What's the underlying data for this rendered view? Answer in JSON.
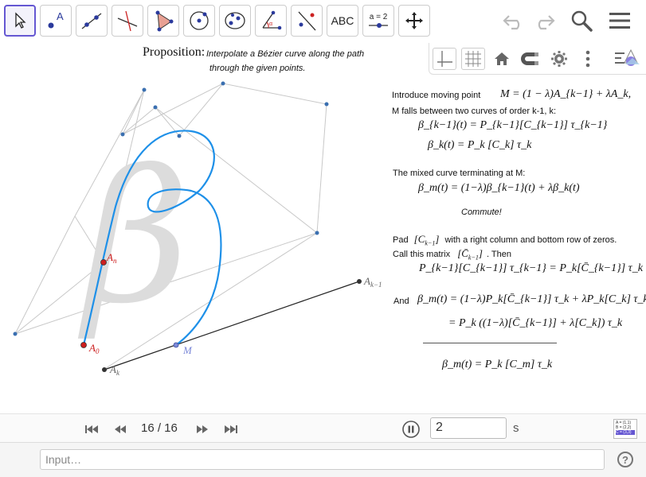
{
  "toolbar": {
    "tools": [
      {
        "name": "move-tool",
        "active": true
      },
      {
        "name": "point-tool"
      },
      {
        "name": "line-tool"
      },
      {
        "name": "perpendicular-line-tool"
      },
      {
        "name": "polygon-tool"
      },
      {
        "name": "circle-tool"
      },
      {
        "name": "ellipse-tool"
      },
      {
        "name": "angle-tool"
      },
      {
        "name": "reflect-tool"
      },
      {
        "name": "text-tool",
        "label": "ABC"
      },
      {
        "name": "slider-tool",
        "label": "a = 2"
      },
      {
        "name": "move-graphics-view-tool"
      }
    ],
    "undo_icon": "undo-icon",
    "redo_icon": "redo-icon",
    "search_icon": "search-icon",
    "menu_icon": "hamburger-menu-icon"
  },
  "stylebar": {
    "buttons": [
      "axes-icon",
      "grid-icon",
      "home-icon",
      "magnet-icon",
      "gear-icon",
      "more-vert-icon",
      "stylebar-toggle-icon"
    ]
  },
  "graphics": {
    "proposition_label": "Proposition:",
    "proposition_text_1": "Interpolate a Bézier curve along the path",
    "proposition_text_2": "through the given points.",
    "intro": "Introduce moving point",
    "intro_eq": "M = (1 − λ)A_{k−1} + λA_k,",
    "falls_between": "M falls between two curves of order k-1, k:",
    "beta_km1": "β_{k−1}(t) = P_{k−1}[C_{k−1}] τ_{k−1}",
    "beta_k": "β_k(t) = P_k [C_k] τ_k",
    "mixed": "The mixed curve terminating at  M:",
    "beta_m": "β_m(t) = (1−λ)β_{k−1}(t) + λβ_k(t)",
    "commute": "Commute!",
    "pad_1": "Pad",
    "pad_2": "with a right column and bottom row of zeros.",
    "call_1": "Call this matrix",
    "call_2": ". Then",
    "then_eq": "P_{k−1}[C_{k−1}] τ_{k−1} = P_k[C̄_{k−1}] τ_k",
    "and_label": "And",
    "and_eq_1": "β_m(t) = (1−λ)P_k[C̄_{k−1}] τ_k + λP_k[C_k] τ_k",
    "and_eq_2": "= P_k ((1−λ)[C̄_{k−1}] + λ[C_k]) τ_k",
    "final_eq": "β_m(t) = P_k [C_m] τ_k",
    "point_labels": {
      "An": "A",
      "An_sub": "n",
      "A0": "A",
      "A0_sub": "0",
      "Ak": "A",
      "Ak_sub": "k",
      "Akm1": "A",
      "Akm1_sub": "k−1",
      "M": "M"
    },
    "colors": {
      "curve": "#1e90e8",
      "red_point": "#cc1f1f",
      "black_point": "#333333",
      "blue_point": "#7c89d8",
      "polygon": "#c8c8c8",
      "beta_glyph": "#dcdcdc"
    }
  },
  "animation": {
    "frame": "16 / 16",
    "speed_value": "2",
    "speed_unit": "s",
    "first_icon": "skip-first-icon",
    "prev_icon": "step-back-icon",
    "next_icon": "step-forward-icon",
    "last_icon": "skip-last-icon",
    "pause_icon": "pause-icon",
    "algebra_lines": [
      "A = (1,1)",
      "B = (2,2)",
      "C = (3,3)"
    ]
  },
  "input_bar": {
    "placeholder": "Input…",
    "help_label": "?"
  }
}
